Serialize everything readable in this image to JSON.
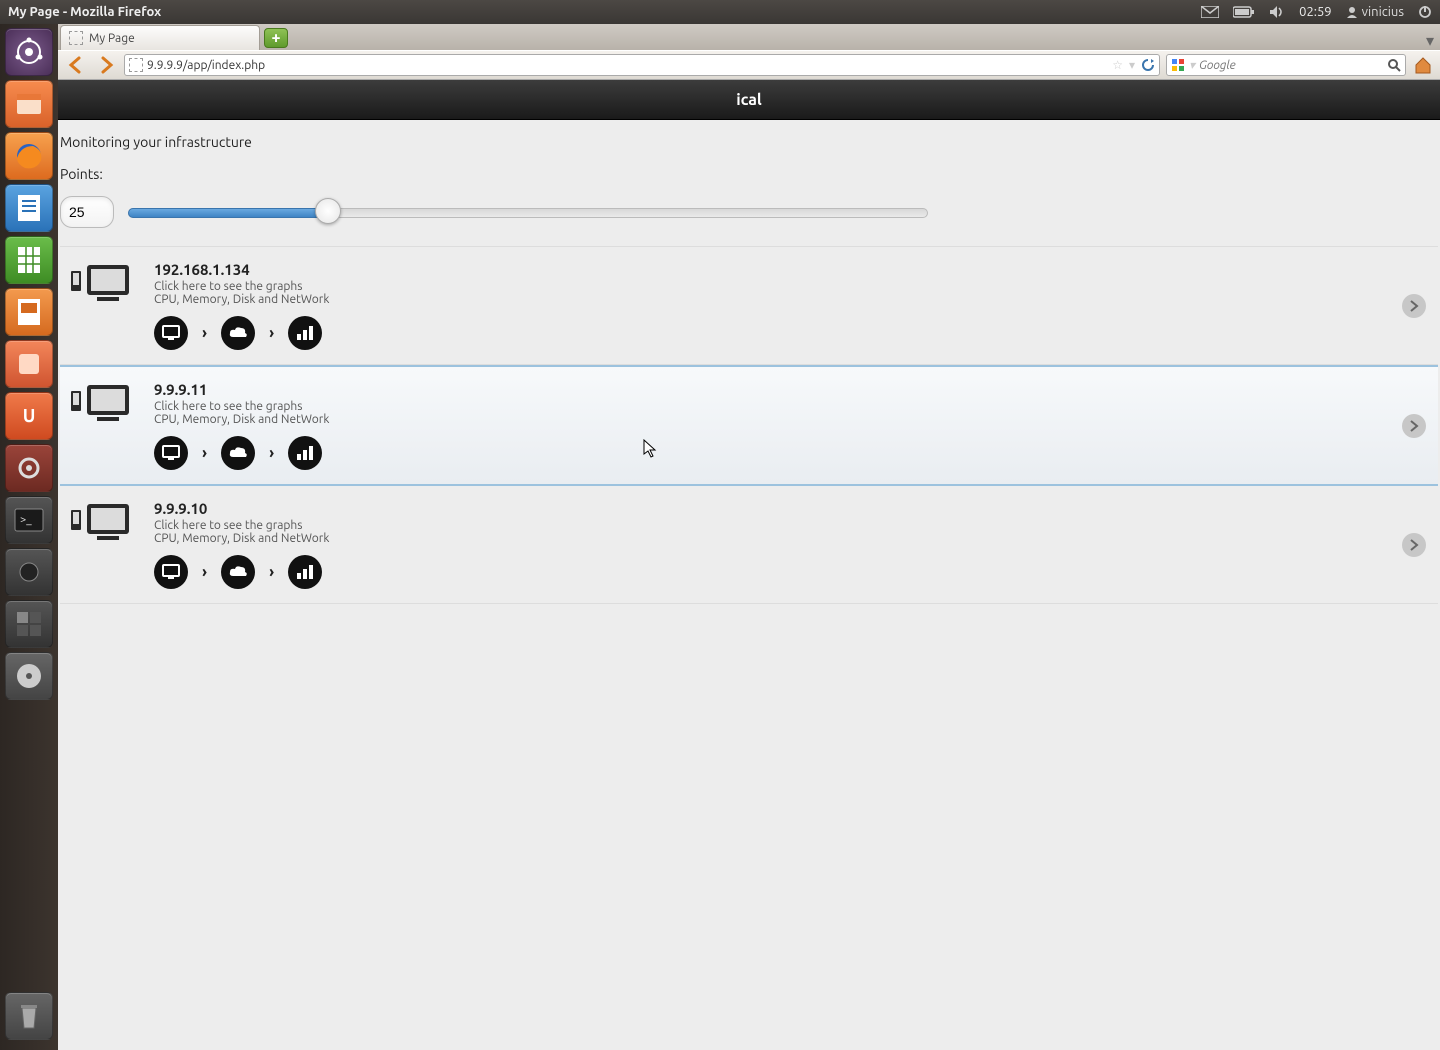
{
  "window_title": "My Page - Mozilla Firefox",
  "panel": {
    "clock": "02:59",
    "username": "vinicius"
  },
  "browser": {
    "tab_title": "My Page",
    "url": "9.9.9.9/app/index.php",
    "search_placeholder": "Google"
  },
  "page": {
    "header": "ical",
    "subtitle": "Monitoring your infrastructure",
    "points_label": "Points:",
    "points_value": "25",
    "slider_percent": 25,
    "hosts": [
      {
        "ip": "192.168.1.134",
        "hint": "Click here to see the graphs",
        "metrics": "CPU, Memory, Disk and NetWork",
        "active": false
      },
      {
        "ip": "9.9.9.11",
        "hint": "Click here to see the graphs",
        "metrics": "CPU, Memory, Disk and NetWork",
        "active": true
      },
      {
        "ip": "9.9.9.10",
        "hint": "Click here to see the graphs",
        "metrics": "CPU, Memory, Disk and NetWork",
        "active": false
      }
    ]
  }
}
